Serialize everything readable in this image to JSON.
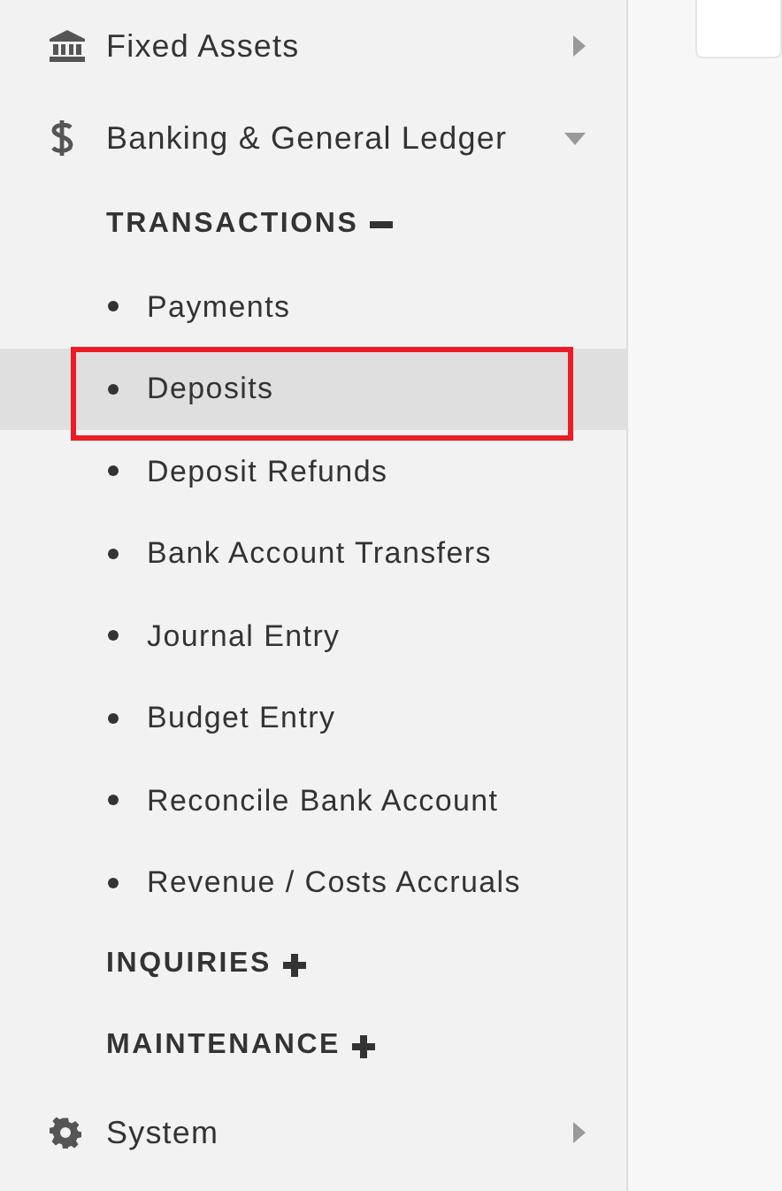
{
  "sidebar": {
    "items": [
      {
        "kind": "bank",
        "label": "Fixed Assets",
        "expanded": false
      },
      {
        "kind": "dollar",
        "label": "Banking & General Ledger",
        "expanded": true,
        "groups": [
          {
            "label": "TRANSACTIONS",
            "expanded": true,
            "items": [
              {
                "label": "Payments",
                "selected": false,
                "annotated": false
              },
              {
                "label": "Deposits",
                "selected": true,
                "annotated": true
              },
              {
                "label": "Deposit Refunds",
                "selected": false,
                "annotated": false
              },
              {
                "label": "Bank Account Transfers",
                "selected": false,
                "annotated": false
              },
              {
                "label": "Journal Entry",
                "selected": false,
                "annotated": false
              },
              {
                "label": "Budget Entry",
                "selected": false,
                "annotated": false
              },
              {
                "label": "Reconcile Bank Account",
                "selected": false,
                "annotated": false
              },
              {
                "label": "Revenue / Costs Accruals",
                "selected": false,
                "annotated": false
              }
            ]
          },
          {
            "label": "INQUIRIES",
            "expanded": false
          },
          {
            "label": "MAINTENANCE",
            "expanded": false
          }
        ]
      },
      {
        "kind": "gear",
        "label": "System",
        "expanded": false
      }
    ]
  }
}
